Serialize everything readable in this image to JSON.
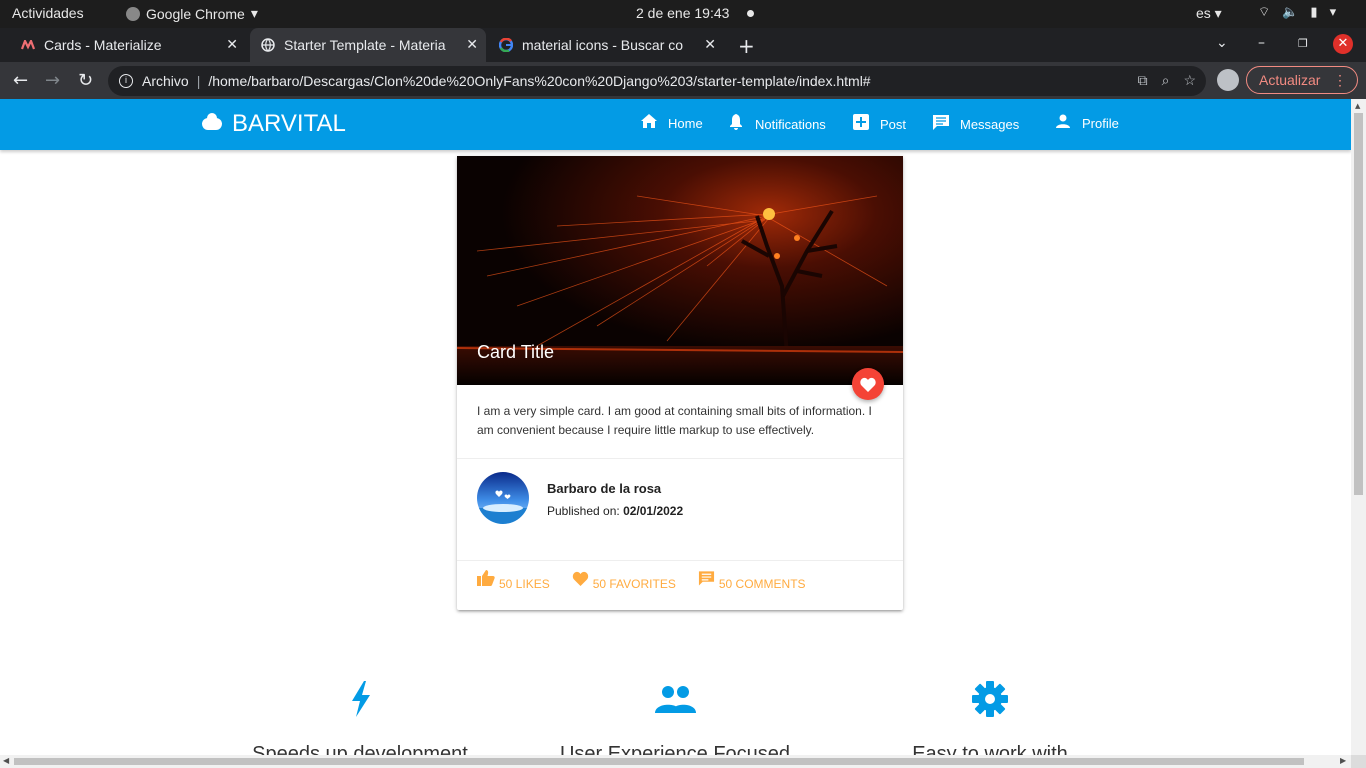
{
  "gnome": {
    "activities": "Actividades",
    "app_name": "Google Chrome",
    "clock": "2 de ene  19:43",
    "lang": "es"
  },
  "tabs": [
    {
      "title": "Cards - Materialize",
      "icon": "materialize-icon"
    },
    {
      "title": "Starter Template - Materia",
      "icon": "globe-icon"
    },
    {
      "title": "material icons - Buscar co",
      "icon": "google-icon"
    }
  ],
  "omnibox": {
    "scheme": "Archivo",
    "url": "/home/barbaro/Descargas/Clon%20de%20OnlyFans%20con%20Django%203/starter-template/index.html#"
  },
  "update_label": "Actualizar",
  "navbar": {
    "brand": "BARVITAL",
    "color": "#039be5",
    "links": [
      {
        "label": "Home",
        "icon": "home-icon"
      },
      {
        "label": "Notifications",
        "icon": "bell-icon"
      },
      {
        "label": "Post",
        "icon": "add-box-icon"
      },
      {
        "label": "Messages",
        "icon": "message-icon"
      },
      {
        "label": "Profile",
        "icon": "person-icon"
      }
    ]
  },
  "card": {
    "title": "Card Title",
    "content": "I am a very simple card. I am good at containing small bits of information. I am convenient because I require little markup to use effectively.",
    "author": "Barbaro de la rosa",
    "published_label": "Published on:",
    "published_date": "02/01/2022",
    "actions": [
      {
        "label": "50 LIKES",
        "icon": "thumb-up-icon"
      },
      {
        "label": "50 FAVORITES",
        "icon": "heart-icon"
      },
      {
        "label": "50 COMMENTS",
        "icon": "comment-icon"
      }
    ],
    "action_color": "#ffab40",
    "fab_color": "#f44336"
  },
  "features": [
    {
      "title": "Speeds up development",
      "icon": "flash-icon"
    },
    {
      "title": "User Experience Focused",
      "icon": "group-icon"
    },
    {
      "title": "Easy to work with",
      "icon": "settings-icon"
    }
  ]
}
